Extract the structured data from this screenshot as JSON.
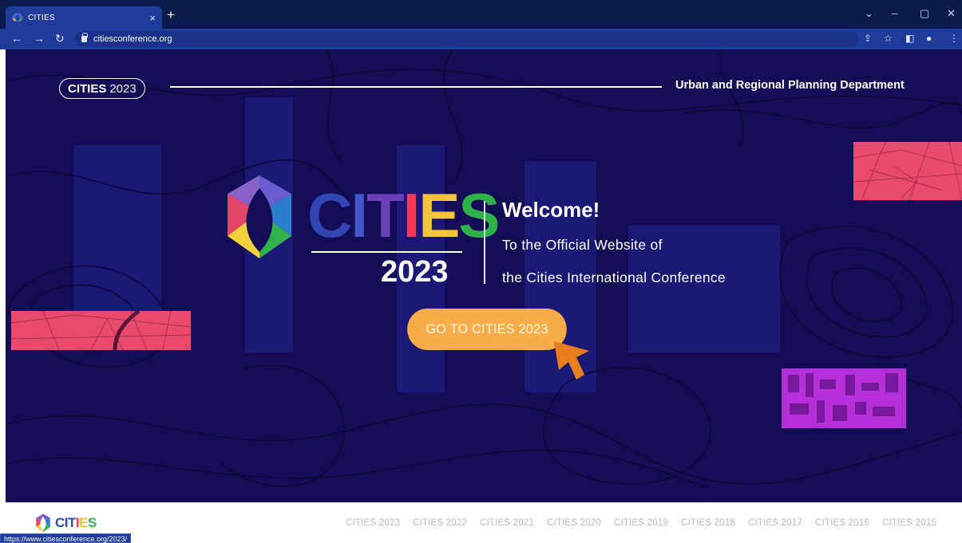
{
  "browser": {
    "tab_title": "CITIES",
    "tab_close": "×",
    "new_tab": "+",
    "url": "citiesconference.org",
    "status_url": "https://www.citiesconference.org/2023/"
  },
  "header": {
    "pill_bold": "CITIES",
    "pill_year": "2023",
    "department": "Urban and Regional Planning Department"
  },
  "hero": {
    "wordmark_letters": [
      {
        "char": "C",
        "color": "#2f46b4"
      },
      {
        "char": "I",
        "color": "#3f57c8"
      },
      {
        "char": "T",
        "color": "#6a3fb8"
      },
      {
        "char": "I",
        "color": "#ef3b5a"
      },
      {
        "char": "E",
        "color": "#f5c53c"
      },
      {
        "char": "S",
        "color": "#2fb24a"
      }
    ],
    "year": "2023",
    "welcome": "Welcome!",
    "tagline_line1": "To the Official Website of",
    "tagline_line2": "the Cities International Conference",
    "cta_label": "GO TO CITIES 2023"
  },
  "footer": {
    "logo_word": "CITIES",
    "year_links": [
      "CITIES 2023",
      "CITIES 2022",
      "CITIES 2021",
      "CITIES 2020",
      "CITIES 2019",
      "CITIES 2018",
      "CITIES 2017",
      "CITIES 2016",
      "CITIES 2015"
    ]
  },
  "colors": {
    "hero_bg": "#140d56",
    "cta": "#f9ad48",
    "map_pink": "#e84a6e",
    "map_magenta": "#b52fd8",
    "cursor": "#e87d1e"
  }
}
